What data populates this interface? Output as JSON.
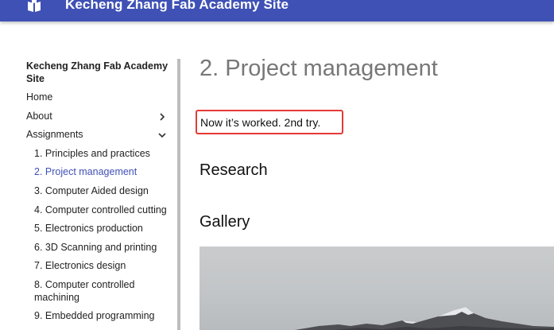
{
  "header": {
    "site_title": "Kecheng Zhang Fab Academy Site"
  },
  "nav": {
    "title": "Kecheng Zhang Fab Academy Site",
    "items": [
      {
        "label": "Home"
      },
      {
        "label": "About"
      },
      {
        "label": "Assignments"
      }
    ],
    "assignments": [
      {
        "label": "1. Principles and practices"
      },
      {
        "label": "2. Project management"
      },
      {
        "label": "3. Computer Aided design"
      },
      {
        "label": "4. Computer controlled cutting"
      },
      {
        "label": "5. Electronics production"
      },
      {
        "label": "6. 3D Scanning and printing"
      },
      {
        "label": "7. Electronics design"
      },
      {
        "label": "8. Computer controlled machining"
      },
      {
        "label": "9. Embedded programming"
      }
    ]
  },
  "main": {
    "title": "2. Project management",
    "intro": "Now it’s worked. 2nd try.",
    "sections": [
      {
        "heading": "Research"
      },
      {
        "heading": "Gallery"
      }
    ]
  },
  "colors": {
    "header_bg": "#3f51b5",
    "active_link": "#3f51b5",
    "highlight_border": "#e53935"
  }
}
